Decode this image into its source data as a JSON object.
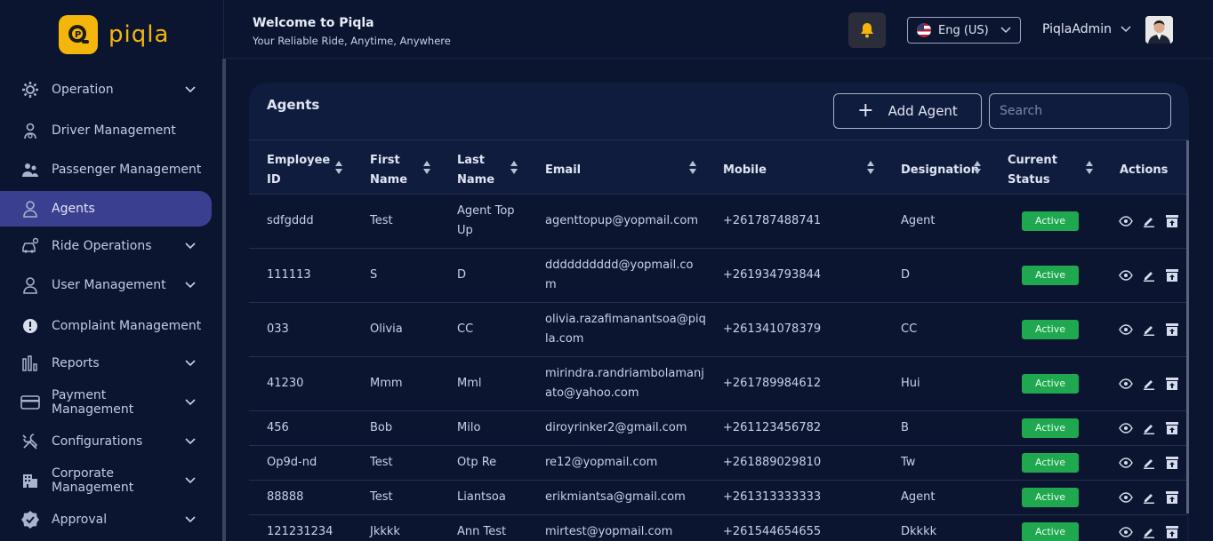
{
  "brand": {
    "name": "piqla"
  },
  "header": {
    "welcome_title": "Welcome to Piqla",
    "welcome_subtitle": "Your Reliable Ride, Anytime, Anywhere",
    "language": "Eng (US)",
    "username": "PiqlaAdmin"
  },
  "sidebar": {
    "items": [
      {
        "label": "Operation",
        "icon": "gear-icon",
        "chevron": true
      },
      {
        "label": "Driver Management",
        "icon": "driver-icon",
        "chevron": false
      },
      {
        "label": "Passenger Management",
        "icon": "passengers-icon",
        "chevron": false
      },
      {
        "label": "Agents",
        "icon": "user-icon",
        "chevron": false,
        "active": true
      },
      {
        "label": "Ride Operations",
        "icon": "car-icon",
        "chevron": true
      },
      {
        "label": "User Management",
        "icon": "user-icon",
        "chevron": true
      },
      {
        "label": "Complaint Management",
        "icon": "alert-icon",
        "chevron": false
      },
      {
        "label": "Reports",
        "icon": "bar-chart-icon",
        "chevron": true
      },
      {
        "label": "Payment Management",
        "icon": "card-icon",
        "chevron": true
      },
      {
        "label": "Configurations",
        "icon": "tools-icon",
        "chevron": true
      },
      {
        "label": "Corporate Management",
        "icon": "building-icon",
        "chevron": true
      },
      {
        "label": "Approval",
        "icon": "badge-check-icon",
        "chevron": true
      }
    ]
  },
  "panel": {
    "title": "Agents",
    "add_button": "Add Agent",
    "search_placeholder": "Search"
  },
  "table": {
    "columns": [
      {
        "l1": "Employee",
        "l2": "ID"
      },
      {
        "l1": "First",
        "l2": "Name"
      },
      {
        "l1": "Last",
        "l2": "Name"
      },
      {
        "l1": "Email",
        "l2": ""
      },
      {
        "l1": "Mobile",
        "l2": ""
      },
      {
        "l1": "Designation",
        "l2": ""
      },
      {
        "l1": "Current",
        "l2": "Status"
      },
      {
        "l1": "Actions",
        "l2": ""
      }
    ],
    "rows": [
      {
        "id": "sdfgddd",
        "first": "Test",
        "last": [
          "Agent Top",
          "Up"
        ],
        "email": [
          "agenttopup@yopmail.com"
        ],
        "mobile": "+261787488741",
        "designation": "Agent",
        "status": "Active"
      },
      {
        "id": "111113",
        "first": "S",
        "last": [
          "D"
        ],
        "email": [
          "dddddddddd@yopmail.co",
          "m"
        ],
        "mobile": "+261934793844",
        "designation": "D",
        "status": "Active"
      },
      {
        "id": "033",
        "first": "Olivia",
        "last": [
          "CC"
        ],
        "email": [
          "olivia.razafimanantsoa@piq",
          "la.com"
        ],
        "mobile": "+261341078379",
        "designation": "CC",
        "status": "Active"
      },
      {
        "id": "41230",
        "first": "Mmm",
        "last": [
          "Mml"
        ],
        "email": [
          "mirindra.randriambolamanj",
          "ato@yahoo.com"
        ],
        "mobile": "+261789984612",
        "designation": "Hui",
        "status": "Active"
      },
      {
        "id": "456",
        "first": "Bob",
        "last": [
          "Milo"
        ],
        "email": [
          "diroyrinker2@gmail.com"
        ],
        "mobile": "+261123456782",
        "designation": "B",
        "status": "Active"
      },
      {
        "id": "Op9d-nd",
        "first": "Test",
        "last": [
          "Otp Re"
        ],
        "email": [
          "re12@yopmail.com"
        ],
        "mobile": "+261889029810",
        "designation": "Tw",
        "status": "Active"
      },
      {
        "id": "88888",
        "first": "Test",
        "last": [
          "Liantsoa"
        ],
        "email": [
          "erikmiantsa@gmail.com"
        ],
        "mobile": "+261313333333",
        "designation": "Agent",
        "status": "Active"
      },
      {
        "id": "121231234",
        "first": "Jkkkk",
        "last": [
          "Ann Test"
        ],
        "email": [
          "mirtest@yopmail.com"
        ],
        "mobile": "+261544654655",
        "designation": "Dkkkk",
        "status": "Active"
      }
    ]
  },
  "colors": {
    "accent": "#f5b60c",
    "active_nav": "#3a3f8f",
    "status_active": "#1fa84f"
  }
}
